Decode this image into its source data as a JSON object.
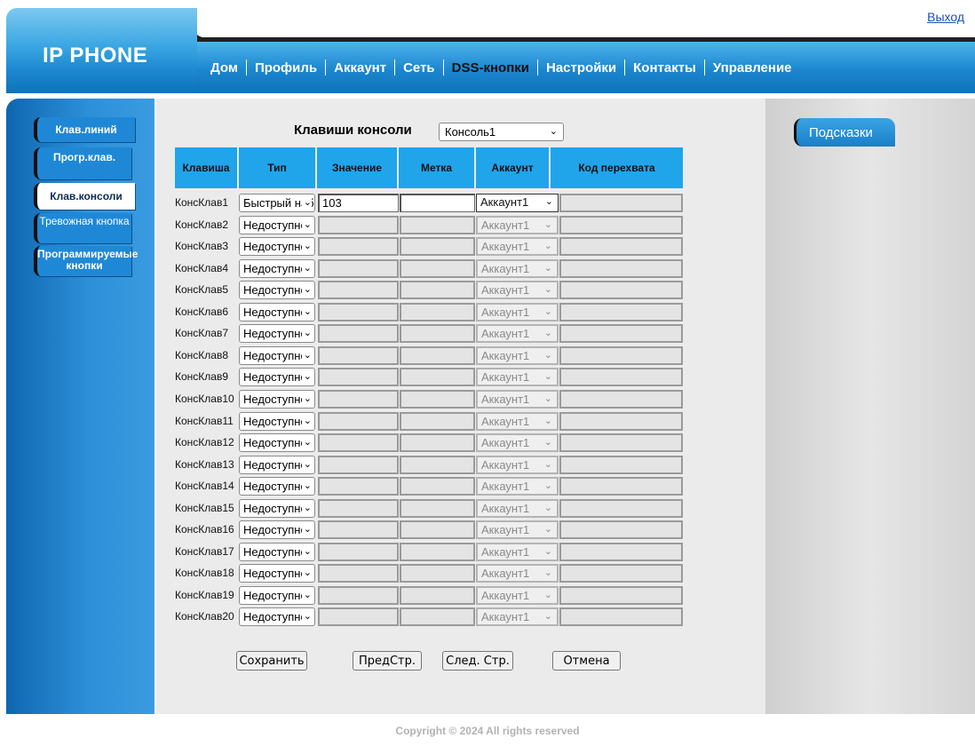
{
  "header": {
    "logout": "Выход",
    "logo": "IP PHONE",
    "nav": [
      "Дом",
      "Профиль",
      "Аккаунт",
      "Сеть",
      "DSS-кнопки",
      "Настройки",
      "Контакты",
      "Управление"
    ],
    "nav_active": "DSS-кнопки"
  },
  "sidebar": {
    "items": [
      "Клав.линий",
      "Прогр.клав.",
      "Клав.консоли",
      "Тревожная кнопка",
      "Программируемые кнопки"
    ],
    "active": "Клав.консоли"
  },
  "main": {
    "title": "Клавиши консоли",
    "console_select": "Консоль1",
    "columns": [
      "Клавиша",
      "Тип",
      "Значение",
      "Метка",
      "Аккаунт",
      "Код перехвата"
    ],
    "rows": [
      {
        "key": "КонсКлав1",
        "type": "Быстрый набор",
        "value": "103",
        "label": "",
        "account": "Аккаунт1",
        "code": "",
        "enabled": true
      },
      {
        "key": "КонсКлав2",
        "type": "Недоступно",
        "value": "",
        "label": "",
        "account": "Аккаунт1",
        "code": "",
        "enabled": false
      },
      {
        "key": "КонсКлав3",
        "type": "Недоступно",
        "value": "",
        "label": "",
        "account": "Аккаунт1",
        "code": "",
        "enabled": false
      },
      {
        "key": "КонсКлав4",
        "type": "Недоступно",
        "value": "",
        "label": "",
        "account": "Аккаунт1",
        "code": "",
        "enabled": false
      },
      {
        "key": "КонсКлав5",
        "type": "Недоступно",
        "value": "",
        "label": "",
        "account": "Аккаунт1",
        "code": "",
        "enabled": false
      },
      {
        "key": "КонсКлав6",
        "type": "Недоступно",
        "value": "",
        "label": "",
        "account": "Аккаунт1",
        "code": "",
        "enabled": false
      },
      {
        "key": "КонсКлав7",
        "type": "Недоступно",
        "value": "",
        "label": "",
        "account": "Аккаунт1",
        "code": "",
        "enabled": false
      },
      {
        "key": "КонсКлав8",
        "type": "Недоступно",
        "value": "",
        "label": "",
        "account": "Аккаунт1",
        "code": "",
        "enabled": false
      },
      {
        "key": "КонсКлав9",
        "type": "Недоступно",
        "value": "",
        "label": "",
        "account": "Аккаунт1",
        "code": "",
        "enabled": false
      },
      {
        "key": "КонсКлав10",
        "type": "Недоступно",
        "value": "",
        "label": "",
        "account": "Аккаунт1",
        "code": "",
        "enabled": false
      },
      {
        "key": "КонсКлав11",
        "type": "Недоступно",
        "value": "",
        "label": "",
        "account": "Аккаунт1",
        "code": "",
        "enabled": false
      },
      {
        "key": "КонсКлав12",
        "type": "Недоступно",
        "value": "",
        "label": "",
        "account": "Аккаунт1",
        "code": "",
        "enabled": false
      },
      {
        "key": "КонсКлав13",
        "type": "Недоступно",
        "value": "",
        "label": "",
        "account": "Аккаунт1",
        "code": "",
        "enabled": false
      },
      {
        "key": "КонсКлав14",
        "type": "Недоступно",
        "value": "",
        "label": "",
        "account": "Аккаунт1",
        "code": "",
        "enabled": false
      },
      {
        "key": "КонсКлав15",
        "type": "Недоступно",
        "value": "",
        "label": "",
        "account": "Аккаунт1",
        "code": "",
        "enabled": false
      },
      {
        "key": "КонсКлав16",
        "type": "Недоступно",
        "value": "",
        "label": "",
        "account": "Аккаунт1",
        "code": "",
        "enabled": false
      },
      {
        "key": "КонсКлав17",
        "type": "Недоступно",
        "value": "",
        "label": "",
        "account": "Аккаунт1",
        "code": "",
        "enabled": false
      },
      {
        "key": "КонсКлав18",
        "type": "Недоступно",
        "value": "",
        "label": "",
        "account": "Аккаунт1",
        "code": "",
        "enabled": false
      },
      {
        "key": "КонсКлав19",
        "type": "Недоступно",
        "value": "",
        "label": "",
        "account": "Аккаунт1",
        "code": "",
        "enabled": false
      },
      {
        "key": "КонсКлав20",
        "type": "Недоступно",
        "value": "",
        "label": "",
        "account": "Аккаунт1",
        "code": "",
        "enabled": false
      }
    ],
    "buttons": {
      "save": "Сохранить",
      "prev": "ПредСтр.",
      "next": "След. Стр.",
      "cancel": "Отмена"
    }
  },
  "tips": {
    "title": "Подсказки"
  },
  "footer": {
    "copyright": "Copyright © 2024 All rights reserved"
  },
  "colors": {
    "header_blue": "#1b86cf",
    "table_header": "#20a4ea",
    "main_bg": "#ebebeb"
  }
}
